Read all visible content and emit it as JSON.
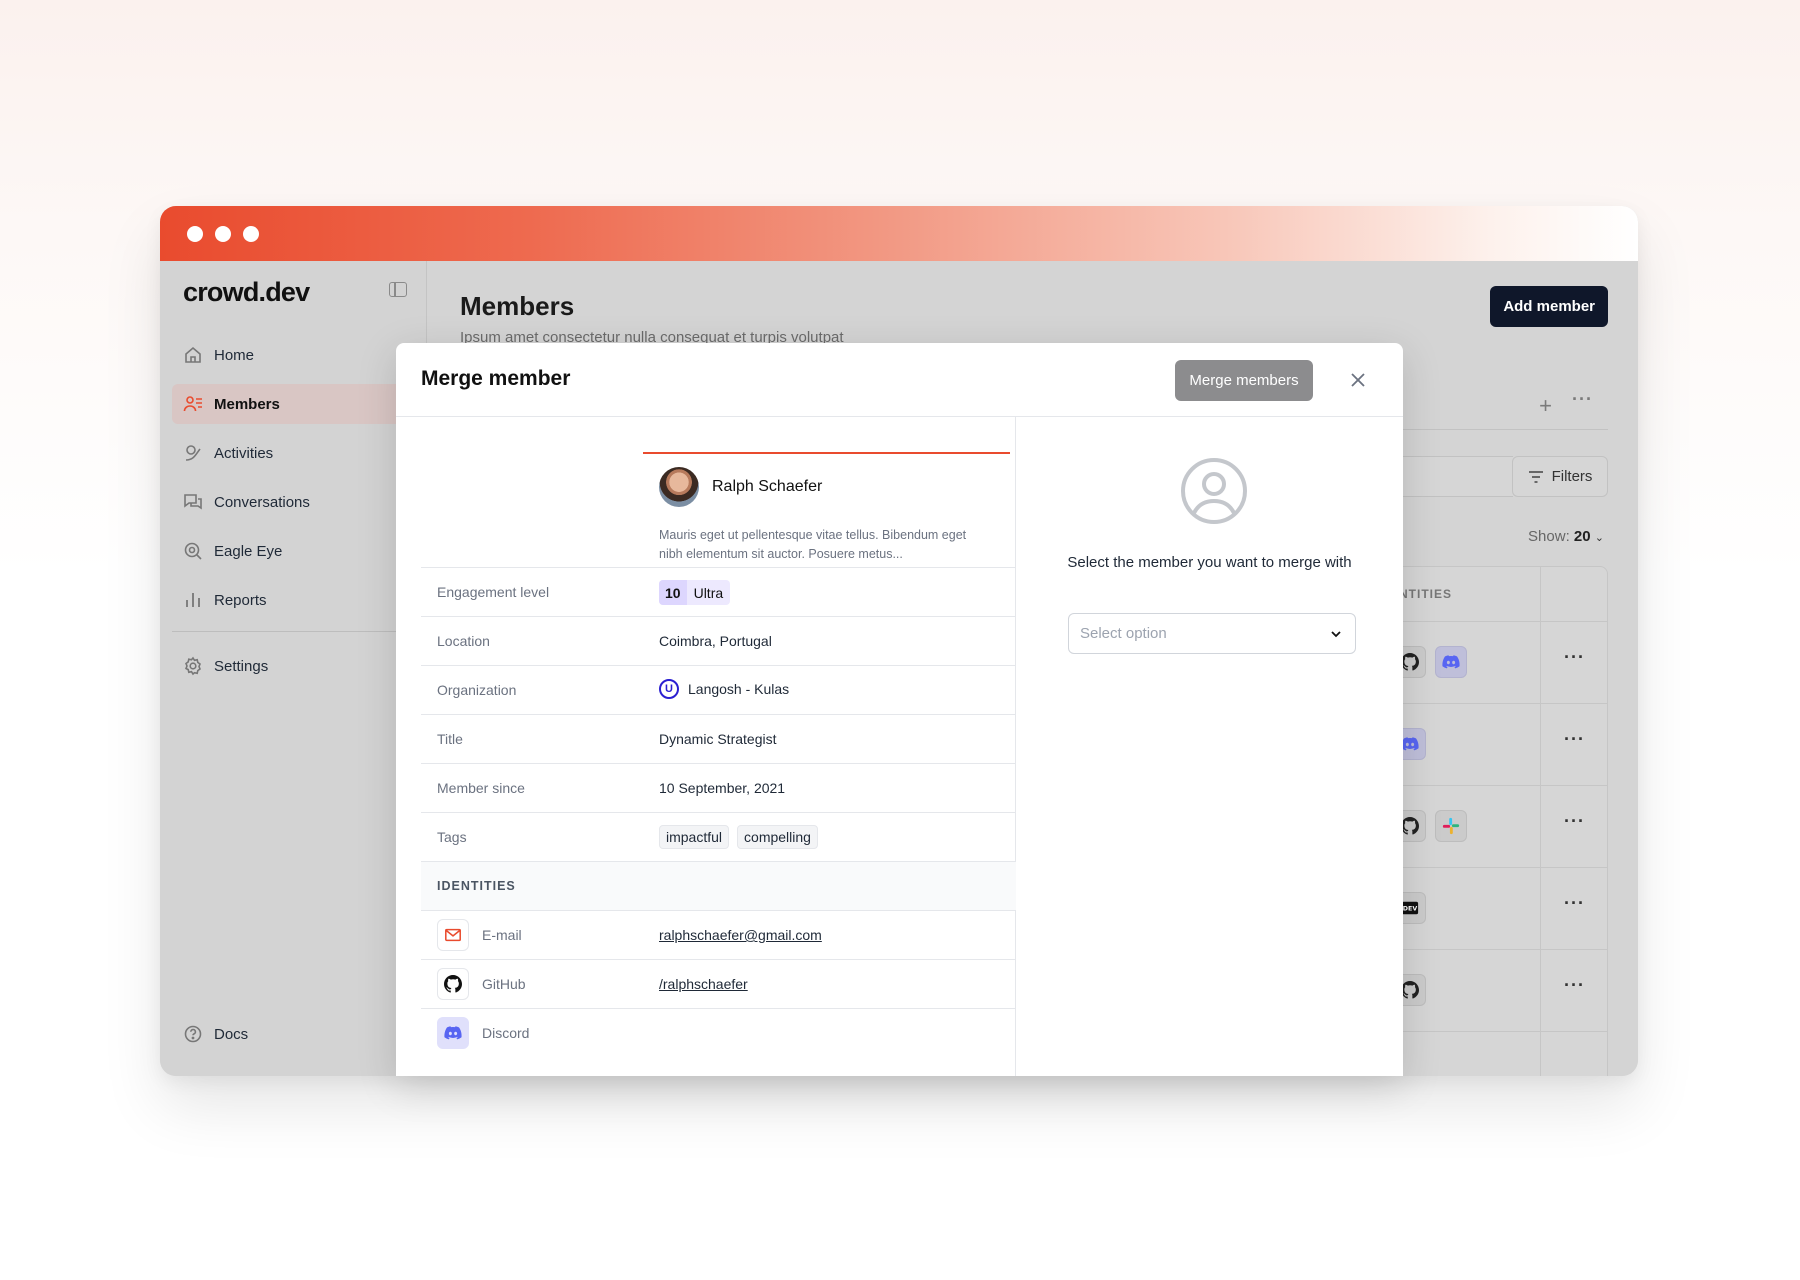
{
  "app": {
    "logo": "crowd.dev"
  },
  "sidebar": {
    "items": [
      {
        "label": "Home",
        "icon": "home-icon"
      },
      {
        "label": "Members",
        "icon": "members-icon",
        "active": true
      },
      {
        "label": "Activities",
        "icon": "activities-icon"
      },
      {
        "label": "Conversations",
        "icon": "conversations-icon"
      },
      {
        "label": "Eagle Eye",
        "icon": "eagle-eye-icon"
      },
      {
        "label": "Reports",
        "icon": "reports-icon"
      }
    ],
    "settings_label": "Settings",
    "docs_label": "Docs"
  },
  "page": {
    "title": "Members",
    "subtitle": "Ipsum amet consectetur nulla consequat et turpis volutpat",
    "add_member_label": "Add member",
    "filters_label": "Filters",
    "show_label": "Show:",
    "show_value": "20",
    "identities_header": "IDENTITIES"
  },
  "modal": {
    "title": "Merge member",
    "merge_button_label": "Merge members",
    "member": {
      "name": "Ralph Schaefer",
      "bio": "Mauris eget ut pellentesque vitae tellus. Bibendum eget nibh elementum sit auctor. Posuere metus..."
    },
    "attributes": {
      "engagement_label": "Engagement level",
      "engagement_score": "10",
      "engagement_level": "Ultra",
      "location_label": "Location",
      "location_value": "Coimbra, Portugal",
      "organization_label": "Organization",
      "organization_logo_letter": "U",
      "organization_value": "Langosh - Kulas",
      "title_label": "Title",
      "title_value": "Dynamic Strategist",
      "member_since_label": "Member since",
      "member_since_value": "10 September, 2021",
      "tags_label": "Tags",
      "tags": [
        "impactful",
        "compelling"
      ]
    },
    "identities": {
      "heading": "IDENTITIES",
      "email_label": "E-mail",
      "email_value": "ralphschaefer@gmail.com",
      "github_label": "GitHub",
      "github_value": "/ralphschaefer",
      "discord_label": "Discord"
    },
    "merge_target": {
      "prompt": "Select the member you want to merge with",
      "select_placeholder": "Select option"
    }
  },
  "colors": {
    "brand": "#e94b2e",
    "primary_button": "#0f172a",
    "discord": "#5865f2"
  }
}
